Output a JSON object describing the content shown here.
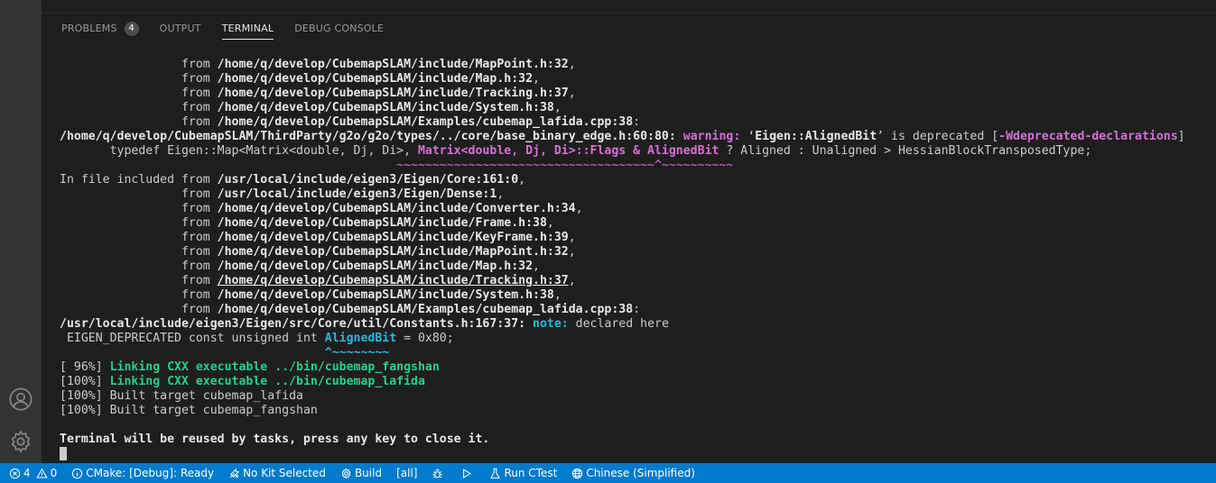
{
  "panel": {
    "tabs": [
      {
        "label": "PROBLEMS",
        "badge": "4"
      },
      {
        "label": "OUTPUT"
      },
      {
        "label": "TERMINAL"
      },
      {
        "label": "DEBUG CONSOLE"
      }
    ],
    "active_tab": "TERMINAL"
  },
  "terminal": {
    "lines": [
      [
        {
          "t": "                 from "
        },
        {
          "t": "/home/q/develop/CubemapSLAM/include/MapPoint.h:32",
          "s": "b"
        },
        {
          "t": ","
        }
      ],
      [
        {
          "t": "                 from "
        },
        {
          "t": "/home/q/develop/CubemapSLAM/include/Map.h:32",
          "s": "b"
        },
        {
          "t": ","
        }
      ],
      [
        {
          "t": "                 from "
        },
        {
          "t": "/home/q/develop/CubemapSLAM/include/Tracking.h:37",
          "s": "b"
        },
        {
          "t": ","
        }
      ],
      [
        {
          "t": "                 from "
        },
        {
          "t": "/home/q/develop/CubemapSLAM/include/System.h:38",
          "s": "b"
        },
        {
          "t": ","
        }
      ],
      [
        {
          "t": "                 from "
        },
        {
          "t": "/home/q/develop/CubemapSLAM/Examples/cubemap_lafida.cpp:38",
          "s": "b"
        },
        {
          "t": ":"
        }
      ],
      [
        {
          "t": "/home/q/develop/CubemapSLAM/ThirdParty/g2o/g2o/types/../core/base_binary_edge.h:60:80:",
          "s": "b"
        },
        {
          "t": " "
        },
        {
          "t": "warning:",
          "s": "mag"
        },
        {
          "t": " ‘"
        },
        {
          "t": "Eigen::AlignedBit",
          "s": "b"
        },
        {
          "t": "’ is deprecated ["
        },
        {
          "t": "-Wdeprecated-declarations",
          "s": "mag"
        },
        {
          "t": "]"
        }
      ],
      [
        {
          "t": "       typedef Eigen::Map<Matrix<double, Dj, Di>, "
        },
        {
          "t": "Matrix<double, Dj, Di>::Flags & AlignedBit",
          "s": "mag"
        },
        {
          "t": " ? Aligned : Unaligned > HessianBlockTransposedType;"
        }
      ],
      [
        {
          "t": "                                               "
        },
        {
          "t": "~~~~~~~~~~~~~~~~~~~~~~~~~~~~~~~~~~~~^~~~~~~~~~~",
          "s": "mag-n"
        }
      ],
      [
        {
          "t": "In file included from "
        },
        {
          "t": "/usr/local/include/eigen3/Eigen/Core:161:0",
          "s": "b"
        },
        {
          "t": ","
        }
      ],
      [
        {
          "t": "                 from "
        },
        {
          "t": "/usr/local/include/eigen3/Eigen/Dense:1",
          "s": "b"
        },
        {
          "t": ","
        }
      ],
      [
        {
          "t": "                 from "
        },
        {
          "t": "/home/q/develop/CubemapSLAM/include/Converter.h:34",
          "s": "b"
        },
        {
          "t": ","
        }
      ],
      [
        {
          "t": "                 from "
        },
        {
          "t": "/home/q/develop/CubemapSLAM/include/Frame.h:38",
          "s": "b"
        },
        {
          "t": ","
        }
      ],
      [
        {
          "t": "                 from "
        },
        {
          "t": "/home/q/develop/CubemapSLAM/include/KeyFrame.h:39",
          "s": "b"
        },
        {
          "t": ","
        }
      ],
      [
        {
          "t": "                 from "
        },
        {
          "t": "/home/q/develop/CubemapSLAM/include/MapPoint.h:32",
          "s": "b"
        },
        {
          "t": ","
        }
      ],
      [
        {
          "t": "                 from "
        },
        {
          "t": "/home/q/develop/CubemapSLAM/include/Map.h:32",
          "s": "b"
        },
        {
          "t": ","
        }
      ],
      [
        {
          "t": "                 from "
        },
        {
          "t": "/home/q/develop/CubemapSLAM/include/Tracking.h:37",
          "s": "bu"
        },
        {
          "t": ","
        }
      ],
      [
        {
          "t": "                 from "
        },
        {
          "t": "/home/q/develop/CubemapSLAM/include/System.h:38",
          "s": "b"
        },
        {
          "t": ","
        }
      ],
      [
        {
          "t": "                 from "
        },
        {
          "t": "/home/q/develop/CubemapSLAM/Examples/cubemap_lafida.cpp:38",
          "s": "b"
        },
        {
          "t": ":"
        }
      ],
      [
        {
          "t": "/usr/local/include/eigen3/Eigen/src/Core/util/Constants.h:167:37:",
          "s": "b"
        },
        {
          "t": " "
        },
        {
          "t": "note:",
          "s": "cyan"
        },
        {
          "t": " declared here"
        }
      ],
      [
        {
          "t": " EIGEN_DEPRECATED const unsigned int "
        },
        {
          "t": "AlignedBit",
          "s": "cyan"
        },
        {
          "t": " = 0x80;"
        }
      ],
      [
        {
          "t": "                                     "
        },
        {
          "t": "^~~~~~~~~",
          "s": "cyan"
        }
      ],
      [
        {
          "t": "[ 96%] "
        },
        {
          "t": "Linking CXX executable ../bin/cubemap_fangshan",
          "s": "green"
        }
      ],
      [
        {
          "t": "[100%] "
        },
        {
          "t": "Linking CXX executable ../bin/cubemap_lafida",
          "s": "green"
        }
      ],
      [
        {
          "t": "[100%] Built target cubemap_lafida"
        }
      ],
      [
        {
          "t": "[100%] Built target cubemap_fangshan"
        }
      ],
      [
        {
          "t": ""
        }
      ],
      [
        {
          "t": "Terminal will be reused by tasks, press any key to close it.",
          "s": "b"
        }
      ]
    ]
  },
  "status_bar": {
    "errors": "4",
    "warnings": "0",
    "cmake": "CMake: [Debug]: Ready",
    "kit": "No Kit Selected",
    "build": "Build",
    "target": "[all]",
    "ctest": "Run CTest",
    "language": "Chinese (Simplified)"
  },
  "icons": [
    "account-icon",
    "manage-gear-icon",
    "error-icon",
    "warning-icon",
    "info-icon",
    "tools-icon",
    "build-gear-icon",
    "debug-bug-icon",
    "run-play-icon",
    "beaker-icon",
    "globe-icon"
  ],
  "colors": {
    "status_bar": "#007acc",
    "activity_bar": "#333333",
    "panel_bg": "#1e1e1e",
    "warning": "#d670d6",
    "note": "#29b8db",
    "success": "#23d18b"
  }
}
